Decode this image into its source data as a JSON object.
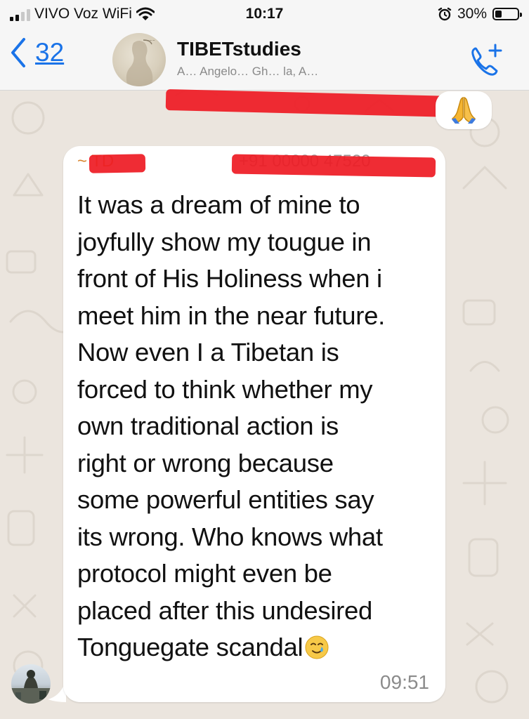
{
  "status_bar": {
    "carrier": "VIVO Voz WiFi",
    "time": "10:17",
    "battery_percent": "30%",
    "battery_level": 0.3,
    "signal_bars_active": 2,
    "icons": [
      "signal-bars-icon",
      "wifi-icon",
      "alarm-clock-icon",
      "battery-icon"
    ]
  },
  "header": {
    "back_count": "32",
    "group_name": "TIBETstudies",
    "members_preview": "A… Angelo… Gh… la, A…",
    "icons": [
      "chevron-left-icon",
      "group-avatar",
      "add-call-icon"
    ]
  },
  "reaction": {
    "emoji": "🙏",
    "icon": "praying-hands-icon"
  },
  "message": {
    "sender_name": "~ TD",
    "sender_phone": "+91 00000 47520",
    "lines": [
      "It was a dream of mine to",
      "joyfully show my tougue in",
      "front of His Holiness when i",
      "meet him in the near future.",
      "Now even I a Tibetan is",
      "forced to think whether my",
      "own traditional action is",
      "right or wrong because",
      "some powerful entities say",
      "its wrong. Who knows what",
      "protocol might even be",
      "placed after this undesired",
      "Tonguegate scandal"
    ],
    "trailing_emoji": "🥲",
    "trailing_emoji_icon": "smiling-face-with-tear-icon",
    "time": "09:51"
  },
  "colors": {
    "accent_blue": "#1a73e8",
    "sender_name": "#d9842c",
    "redaction_red": "#ee1c25",
    "chat_background": "#ebe5de",
    "bubble": "#ffffff",
    "timestamp": "#8b8b8b"
  }
}
